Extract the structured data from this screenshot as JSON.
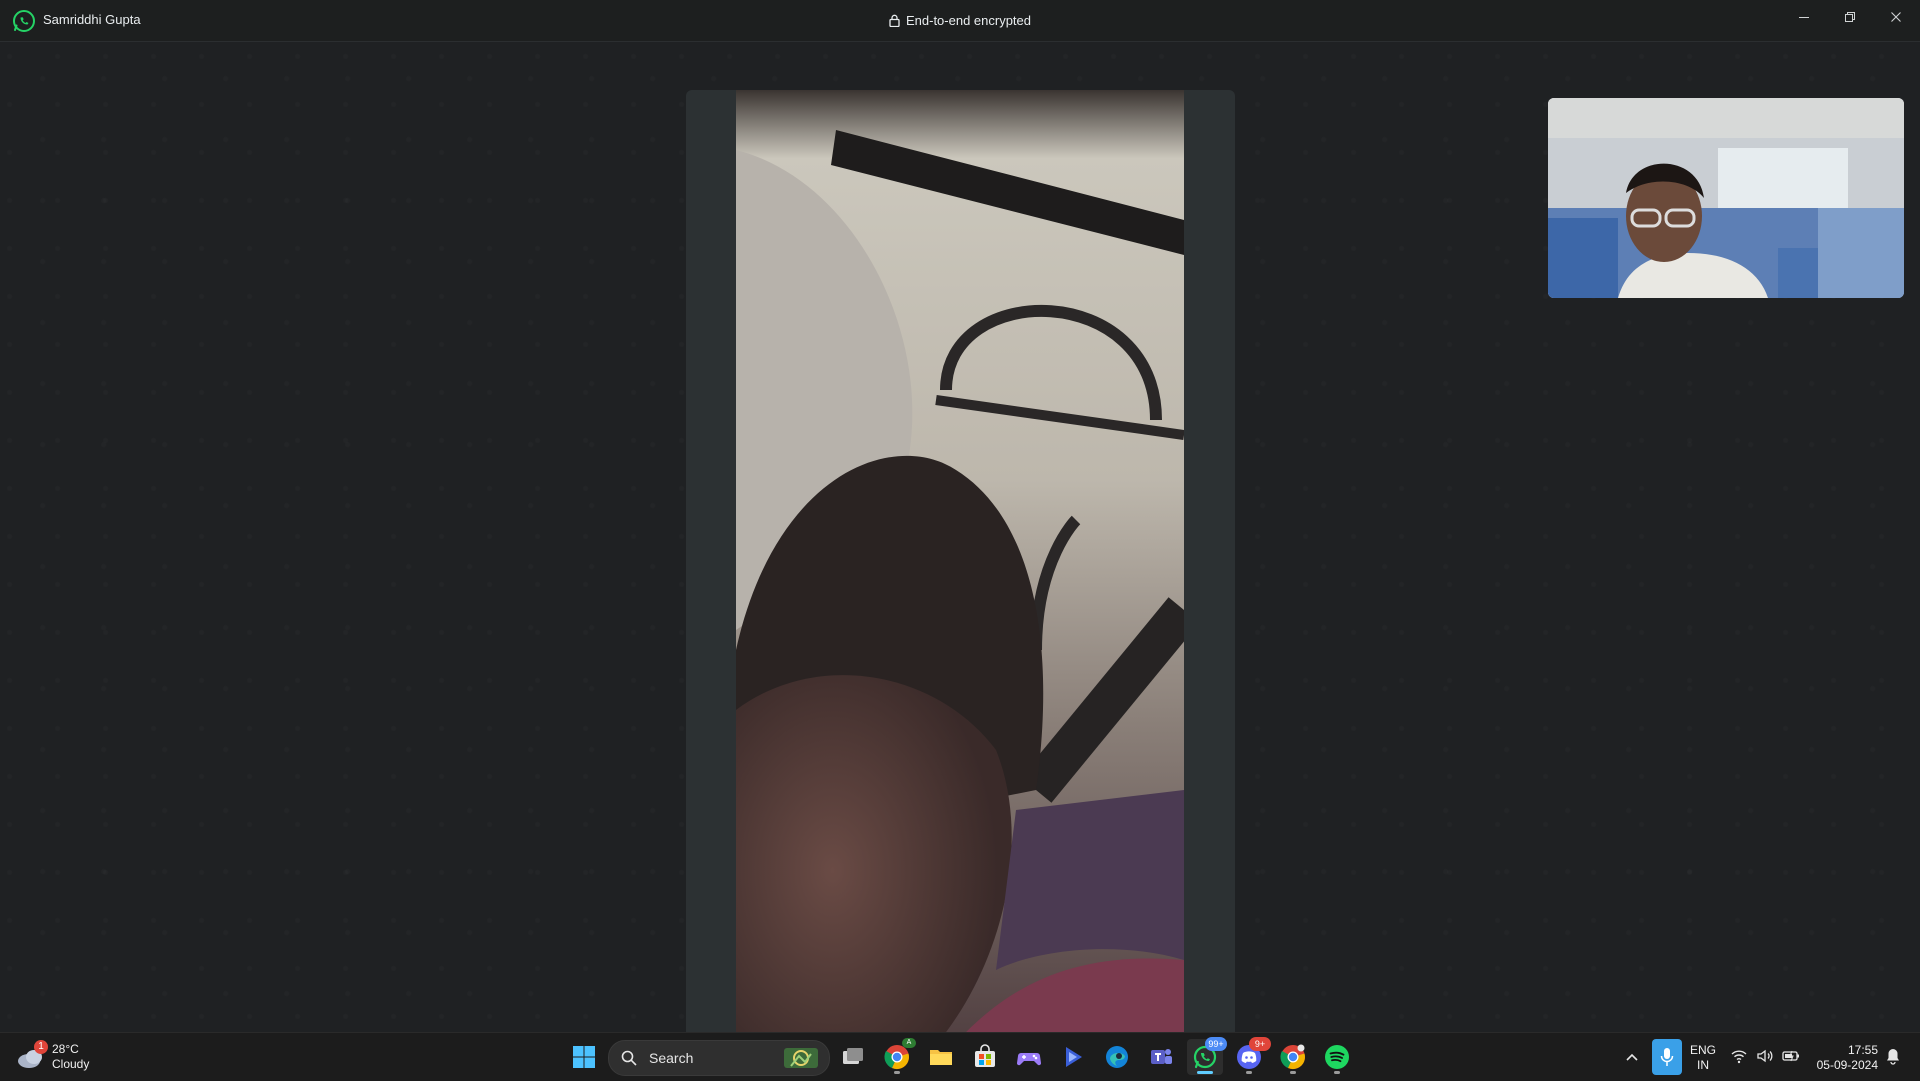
{
  "window": {
    "contact_name": "Samriddhi Gupta",
    "encryption_label": "End-to-end encrypted",
    "controls": {
      "minimize": "minimize-icon",
      "restore": "restore-icon",
      "close": "close-icon"
    }
  },
  "call": {
    "remote_video": "remote participant video",
    "self_view": "self camera preview"
  },
  "taskbar": {
    "weather": {
      "temperature": "28°C",
      "condition": "Cloudy",
      "badge": "1"
    },
    "search": {
      "placeholder": "Search"
    },
    "apps": [
      {
        "name": "start",
        "icon": "windows-icon"
      },
      {
        "name": "task-view",
        "icon": "task-view-icon"
      },
      {
        "name": "chrome",
        "icon": "chrome-icon",
        "badge": ""
      },
      {
        "name": "file-explorer",
        "icon": "folder-icon"
      },
      {
        "name": "microsoft-store",
        "icon": "store-icon"
      },
      {
        "name": "game",
        "icon": "gamepad-icon"
      },
      {
        "name": "copilot",
        "icon": "play-icon"
      },
      {
        "name": "edge",
        "icon": "edge-icon"
      },
      {
        "name": "teams",
        "icon": "teams-icon"
      },
      {
        "name": "whatsapp",
        "icon": "whatsapp-icon",
        "badge": "99+"
      },
      {
        "name": "discord",
        "icon": "discord-icon",
        "badge": "9+"
      },
      {
        "name": "chrome-profile",
        "icon": "chrome-icon"
      },
      {
        "name": "spotify",
        "icon": "spotify-icon"
      }
    ],
    "language": {
      "line1": "ENG",
      "line2": "IN"
    },
    "clock": {
      "time": "17:55",
      "date": "05-09-2024"
    },
    "colors": {
      "accent": "#60cdff",
      "badge_blue": "#4c8bf5",
      "badge_red": "#e0453a",
      "whatsapp_green": "#25d366"
    }
  }
}
